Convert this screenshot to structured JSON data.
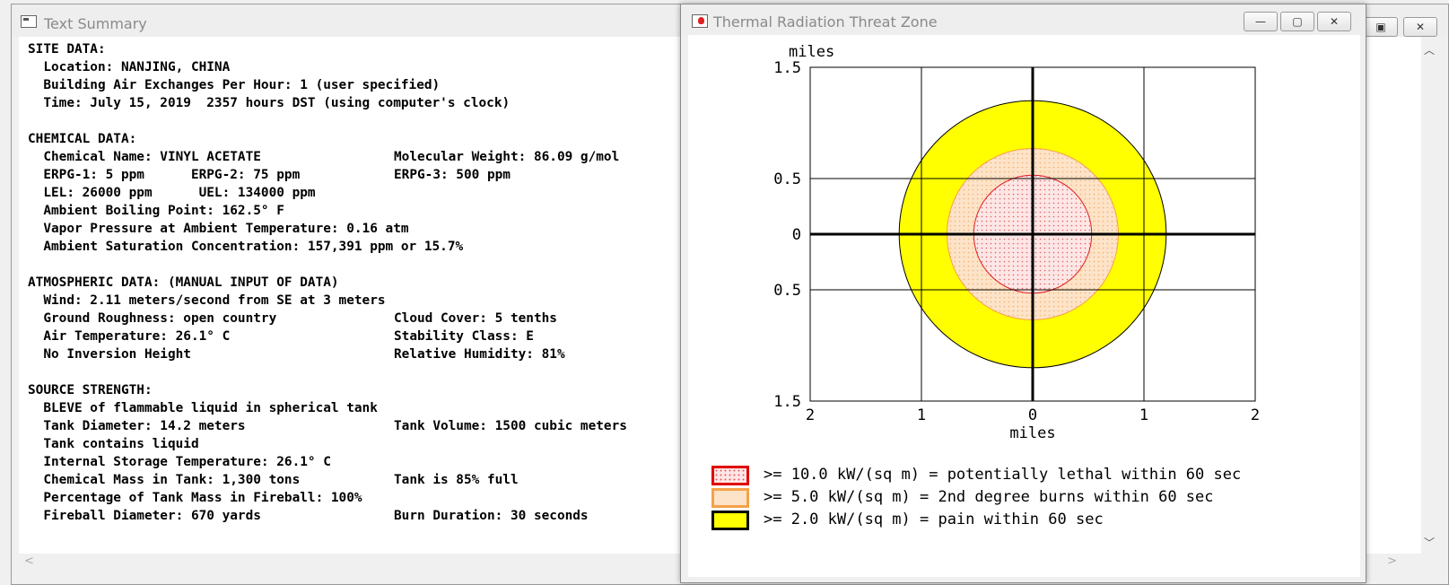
{
  "summary_window": {
    "title": "Text Summary",
    "lines": [
      {
        "left": "SITE DATA:",
        "right": ""
      },
      {
        "left": "  Location: NANJING, CHINA",
        "right": ""
      },
      {
        "left": "  Building Air Exchanges Per Hour: 1 (user specified)",
        "right": ""
      },
      {
        "left": "  Time: July 15, 2019  2357 hours DST (using computer's clock)",
        "right": ""
      },
      {
        "left": "",
        "right": ""
      },
      {
        "left": "CHEMICAL DATA:",
        "right": ""
      },
      {
        "left": "  Chemical Name: VINYL ACETATE",
        "right": "Molecular Weight: 86.09 g/mol"
      },
      {
        "left": "  ERPG-1: 5 ppm      ERPG-2: 75 ppm",
        "right": "ERPG-3: 500 ppm"
      },
      {
        "left": "  LEL: 26000 ppm      UEL: 134000 ppm",
        "right": ""
      },
      {
        "left": "  Ambient Boiling Point: 162.5° F",
        "right": ""
      },
      {
        "left": "  Vapor Pressure at Ambient Temperature: 0.16 atm",
        "right": ""
      },
      {
        "left": "  Ambient Saturation Concentration: 157,391 ppm or 15.7%",
        "right": ""
      },
      {
        "left": "",
        "right": ""
      },
      {
        "left": "ATMOSPHERIC DATA: (MANUAL INPUT OF DATA)",
        "right": ""
      },
      {
        "left": "  Wind: 2.11 meters/second from SE at 3 meters",
        "right": ""
      },
      {
        "left": "  Ground Roughness: open country",
        "right": "Cloud Cover: 5 tenths"
      },
      {
        "left": "  Air Temperature: 26.1° C",
        "right": "Stability Class: E"
      },
      {
        "left": "  No Inversion Height",
        "right": "Relative Humidity: 81%"
      },
      {
        "left": "",
        "right": ""
      },
      {
        "left": "SOURCE STRENGTH:",
        "right": ""
      },
      {
        "left": "  BLEVE of flammable liquid in spherical tank",
        "right": ""
      },
      {
        "left": "  Tank Diameter: 14.2 meters",
        "right": "Tank Volume: 1500 cubic meters"
      },
      {
        "left": "  Tank contains liquid",
        "right": ""
      },
      {
        "left": "  Internal Storage Temperature: 26.1° C",
        "right": ""
      },
      {
        "left": "  Chemical Mass in Tank: 1,300 tons",
        "right": "Tank is 85% full"
      },
      {
        "left": "  Percentage of Tank Mass in Fireball: 100%",
        "right": ""
      },
      {
        "left": "  Fireball Diameter: 670 yards",
        "right": "Burn Duration: 30 seconds"
      }
    ]
  },
  "thermal_window": {
    "title": "Thermal Radiation Threat Zone",
    "buttons": {
      "minimize": "—",
      "maximize": "▢",
      "close": "✕"
    }
  },
  "chart_data": {
    "type": "threat-zone",
    "xlabel": "miles",
    "ylabel": "miles",
    "xlim": [
      -2,
      2
    ],
    "ylim": [
      -1.5,
      1.5
    ],
    "x_ticks": [
      {
        "v": -2,
        "label": "2"
      },
      {
        "v": -1,
        "label": "1"
      },
      {
        "v": 0,
        "label": "0"
      },
      {
        "v": 1,
        "label": "1"
      },
      {
        "v": 2,
        "label": "2"
      }
    ],
    "y_ticks": [
      {
        "v": 1.5,
        "label": "1.5"
      },
      {
        "v": 0.5,
        "label": "0.5"
      },
      {
        "v": 0,
        "label": "0"
      },
      {
        "v": -0.5,
        "label": "0.5"
      },
      {
        "v": -1.5,
        "label": "1.5"
      }
    ],
    "grid": true,
    "zones": [
      {
        "name": "yellow",
        "radius_miles": 1.2,
        "fill": "#ffff00",
        "stroke": "#000000",
        "pattern": "solid"
      },
      {
        "name": "orange",
        "radius_miles": 0.77,
        "fill": "#fde3c8",
        "stroke": "#f5a14a",
        "pattern": "dots-light"
      },
      {
        "name": "red",
        "radius_miles": 0.53,
        "fill": "#fde6e6",
        "stroke": "#e02020",
        "pattern": "dots-red"
      }
    ],
    "legend": [
      {
        "label": ">= 10.0 kW/(sq m) = potentially lethal within 60 sec",
        "border": "#e00000",
        "fill": "#ffe6e6",
        "pattern": "dots"
      },
      {
        "label": ">= 5.0 kW/(sq m) = 2nd degree burns within 60 sec",
        "border": "#f5a14a",
        "fill": "#fde3c8",
        "pattern": "none"
      },
      {
        "label": ">= 2.0 kW/(sq m) = pain within 60 sec",
        "border": "#000000",
        "fill": "#ffff00",
        "pattern": "none"
      }
    ]
  }
}
